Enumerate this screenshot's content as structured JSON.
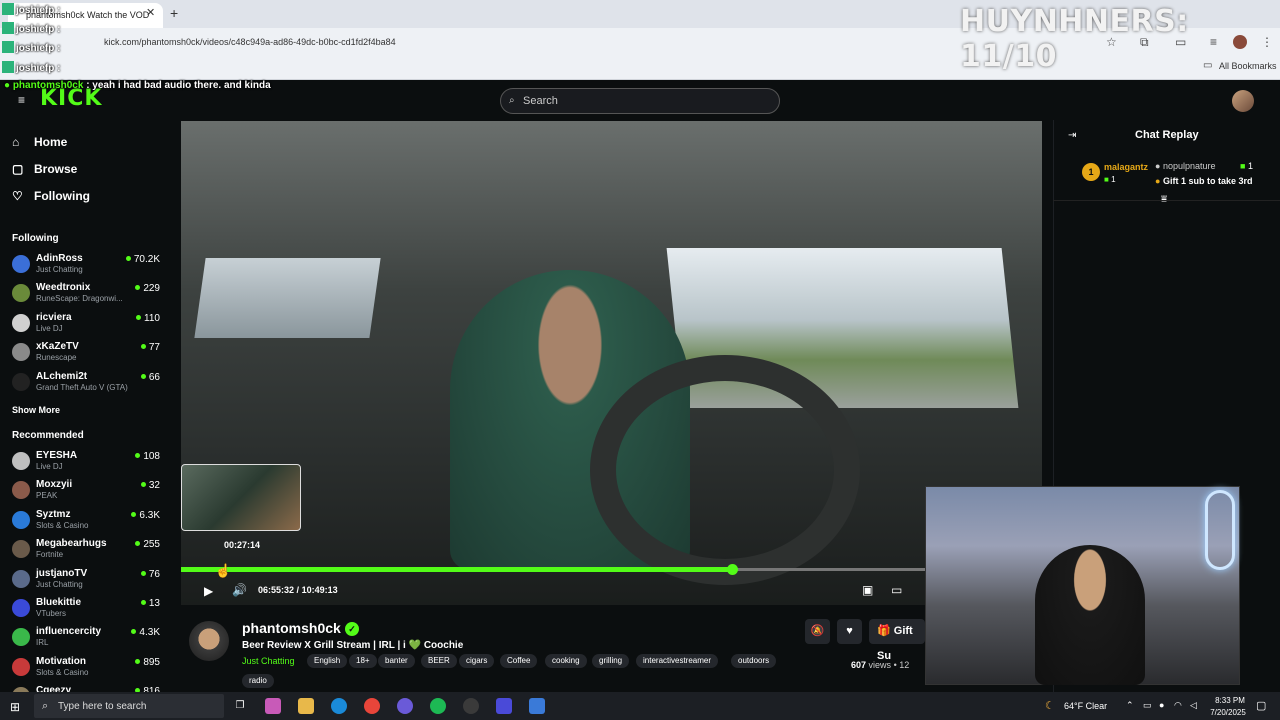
{
  "browser": {
    "tab_title": "phantomsh0ck Watch the VOD",
    "url": "kick.com/phantomsh0ck/videos/c48c949a-ad86-49dc-b0bc-cd1fd2f4ba84",
    "all_bookmarks": "All Bookmarks",
    "new_tab": "+",
    "close_tab": "✕"
  },
  "header": {
    "logo": "KICK",
    "search_placeholder": "Search"
  },
  "sidebar": {
    "nav": [
      {
        "label": "Home",
        "icon": "home-icon"
      },
      {
        "label": "Browse",
        "icon": "browse-icon"
      },
      {
        "label": "Following",
        "icon": "heart-icon"
      }
    ],
    "following_heading": "Following",
    "following": [
      {
        "name": "AdinRoss",
        "category": "Just Chatting",
        "viewers": "70.2K",
        "color": "#3b6fd8"
      },
      {
        "name": "Weedtronix",
        "category": "RuneScape: Dragonwi...",
        "viewers": "229",
        "color": "#6a8a3a"
      },
      {
        "name": "ricviera",
        "category": "Live DJ",
        "viewers": "110",
        "color": "#d0d0d0"
      },
      {
        "name": "xKaZeTV",
        "category": "Runescape",
        "viewers": "77",
        "color": "#8a8a8a"
      },
      {
        "name": "ALchemi2t",
        "category": "Grand Theft Auto V (GTA)",
        "viewers": "66",
        "color": "#222222"
      }
    ],
    "show_more": "Show More",
    "recommended_heading": "Recommended",
    "recommended": [
      {
        "name": "EYESHA",
        "category": "Live DJ",
        "viewers": "108",
        "color": "#bfbfbf"
      },
      {
        "name": "Moxzyii",
        "category": "PEAK",
        "viewers": "32",
        "color": "#8a5a4a"
      },
      {
        "name": "Syztmz",
        "category": "Slots & Casino",
        "viewers": "6.3K",
        "color": "#2a7ad8"
      },
      {
        "name": "Megabearhugs",
        "category": "Fortnite",
        "viewers": "255",
        "color": "#6a5a4a"
      },
      {
        "name": "justjanoTV",
        "category": "Just Chatting",
        "viewers": "76",
        "color": "#5a6a8a"
      },
      {
        "name": "Bluekittie",
        "category": "VTubers",
        "viewers": "13",
        "color": "#3a4ad8"
      },
      {
        "name": "influencercity",
        "category": "IRL",
        "viewers": "4.3K",
        "color": "#3ab84a"
      },
      {
        "name": "Motivation",
        "category": "Slots & Casino",
        "viewers": "895",
        "color": "#c83a3a"
      },
      {
        "name": "Cgeezy",
        "category": "",
        "viewers": "816",
        "color": "#8a7a5a"
      }
    ]
  },
  "player": {
    "preview_time": "00:27:14",
    "current_time": "06:55:32",
    "separator": "/",
    "duration": "10:49:13",
    "progress": 0.64
  },
  "stream": {
    "channel": "phantomsh0ck",
    "title": "Beer Review X Grill Stream | IRL | i 💚 Coochie",
    "category": "Just Chatting",
    "tags": [
      "English",
      "18+",
      "banter",
      "BEER",
      "cigars",
      "Coffee",
      "cooking",
      "grilling",
      "interactivestreamer",
      "outdoors"
    ],
    "tag_last": "radio",
    "views": "607",
    "views_label": "views",
    "views_extra": "• 12",
    "gift_button": "Gift Su"
  },
  "chat": {
    "title": "Chat Replay",
    "gifter": "malagantz",
    "gifter_badge": "1",
    "gifter_count": "1",
    "receiver": "nopulpnature",
    "gift_count": "1",
    "gift_message": "Gift 1 sub to take 3rd"
  },
  "overlay": {
    "title": "HUYNHNERS: 11/10",
    "chat_users": [
      "joshiefp :",
      "joshiefp :",
      "joshiefp :",
      "joshiefp :"
    ],
    "message_user": "phantomsh0ck",
    "message_text": ": yeah i had bad audio there. and kinda"
  },
  "taskbar": {
    "search_placeholder": "Type here to search",
    "weather": "64°F  Clear",
    "time": "8:33 PM",
    "date": "7/20/2025"
  },
  "colors": {
    "brand": "#53fc18",
    "gold": "#e6a817"
  }
}
